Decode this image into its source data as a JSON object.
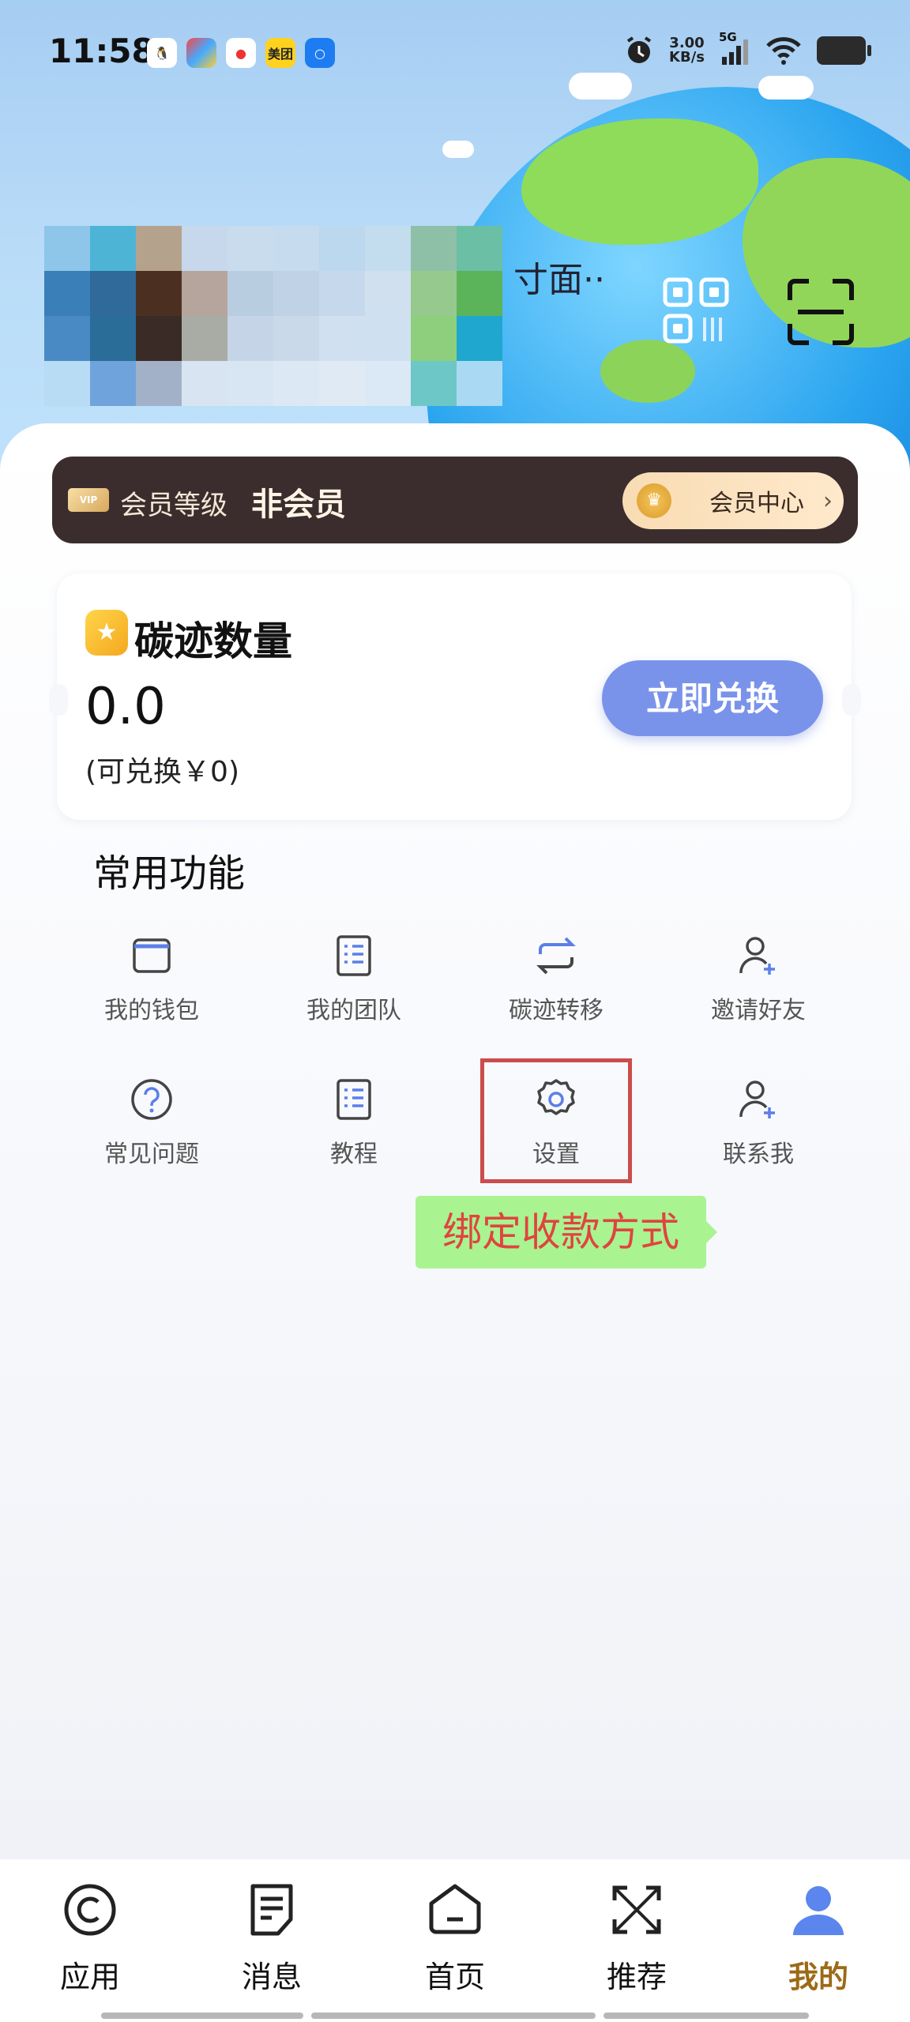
{
  "status_bar": {
    "time": "11:58",
    "speed_value": "3.00",
    "speed_unit": "KB/s",
    "network": "5G",
    "apps": [
      {
        "name": "qq-icon",
        "color": "#ffffff"
      },
      {
        "name": "photos-icon",
        "color": "#ffffff"
      },
      {
        "name": "map-icon",
        "color": "#ffffff"
      },
      {
        "name": "meituan-icon",
        "label": "美团",
        "color": "#ffd21f"
      },
      {
        "name": "browser-icon",
        "color": "#ffffff"
      }
    ]
  },
  "profile": {
    "name_fragment": "寸面··"
  },
  "vip": {
    "card_text": "VIP",
    "label": "会员等级",
    "value": "非会员",
    "center_button": "会员中心"
  },
  "carbon": {
    "title": "碳迹数量",
    "amount": "0.0",
    "exchangeable": "(可兑换￥0)",
    "redeem_button": "立即兑换"
  },
  "functions": {
    "title": "常用功能",
    "items": [
      {
        "label": "我的钱包",
        "icon": "wallet-icon"
      },
      {
        "label": "我的团队",
        "icon": "team-icon"
      },
      {
        "label": "碳迹转移",
        "icon": "transfer-icon"
      },
      {
        "label": "邀请好友",
        "icon": "invite-icon"
      },
      {
        "label": "常见问题",
        "icon": "faq-icon"
      },
      {
        "label": "教程",
        "icon": "tutorial-icon"
      },
      {
        "label": "设置",
        "icon": "settings-icon"
      },
      {
        "label": "联系我",
        "icon": "contact-icon"
      }
    ]
  },
  "annotation": {
    "tip": "绑定收款方式",
    "highlight_color": "#cc4c4c"
  },
  "bottom_nav": {
    "items": [
      {
        "label": "应用",
        "icon": "apps-icon"
      },
      {
        "label": "消息",
        "icon": "message-icon"
      },
      {
        "label": "首页",
        "icon": "home-icon"
      },
      {
        "label": "推荐",
        "icon": "recommend-icon"
      },
      {
        "label": "我的",
        "icon": "profile-icon",
        "active": true
      }
    ],
    "active_color": "#9c6a16"
  },
  "colors": {
    "accent_blue": "#7a93ea",
    "vip_dark": "#3b2d2d"
  }
}
